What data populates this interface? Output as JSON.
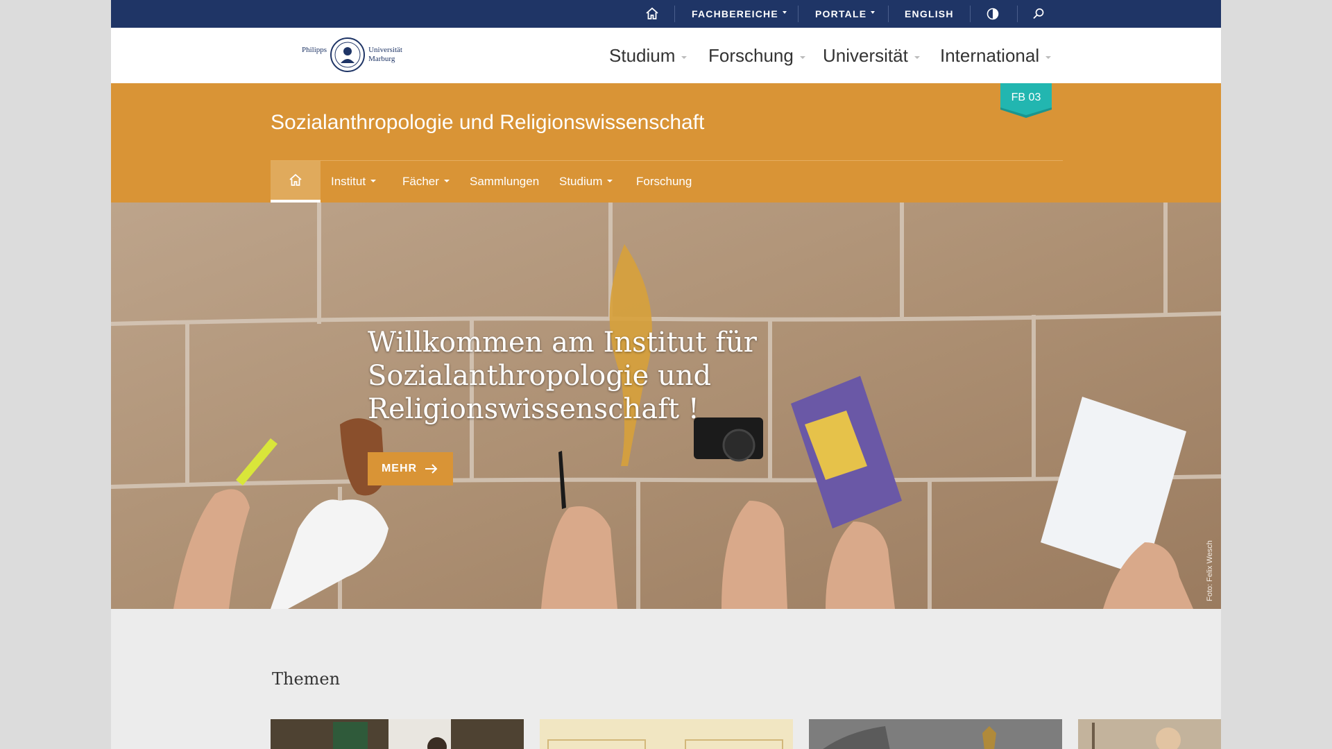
{
  "topbar": {
    "fachbereiche": "FACHBEREICHE",
    "portale": "PORTALE",
    "english": "ENGLISH"
  },
  "header": {
    "logo_text_left": "Philipps",
    "logo_text_right_1": "Universität",
    "logo_text_right_2": "Marburg",
    "nav": [
      "Studium",
      "Forschung",
      "Universität",
      "International"
    ]
  },
  "band": {
    "title": "Sozialanthropologie und Religionswissenschaft",
    "badge": "FB 03",
    "subnav": {
      "institut": "Institut",
      "faecher": "Fächer",
      "sammlungen": "Sammlungen",
      "studium": "Studium",
      "forschung": "Forschung"
    }
  },
  "hero": {
    "headline_lines": [
      "Willkommen am Institut für",
      "Sozialanthropologie und",
      "Religionswissenschaft !"
    ],
    "button": "MEHR",
    "credit": "Foto: Felix Wesch"
  },
  "themen": {
    "title": "Themen"
  },
  "colors": {
    "topbar": "#1f3566",
    "accent_orange": "#d99436",
    "badge_teal": "#22b6b0"
  }
}
